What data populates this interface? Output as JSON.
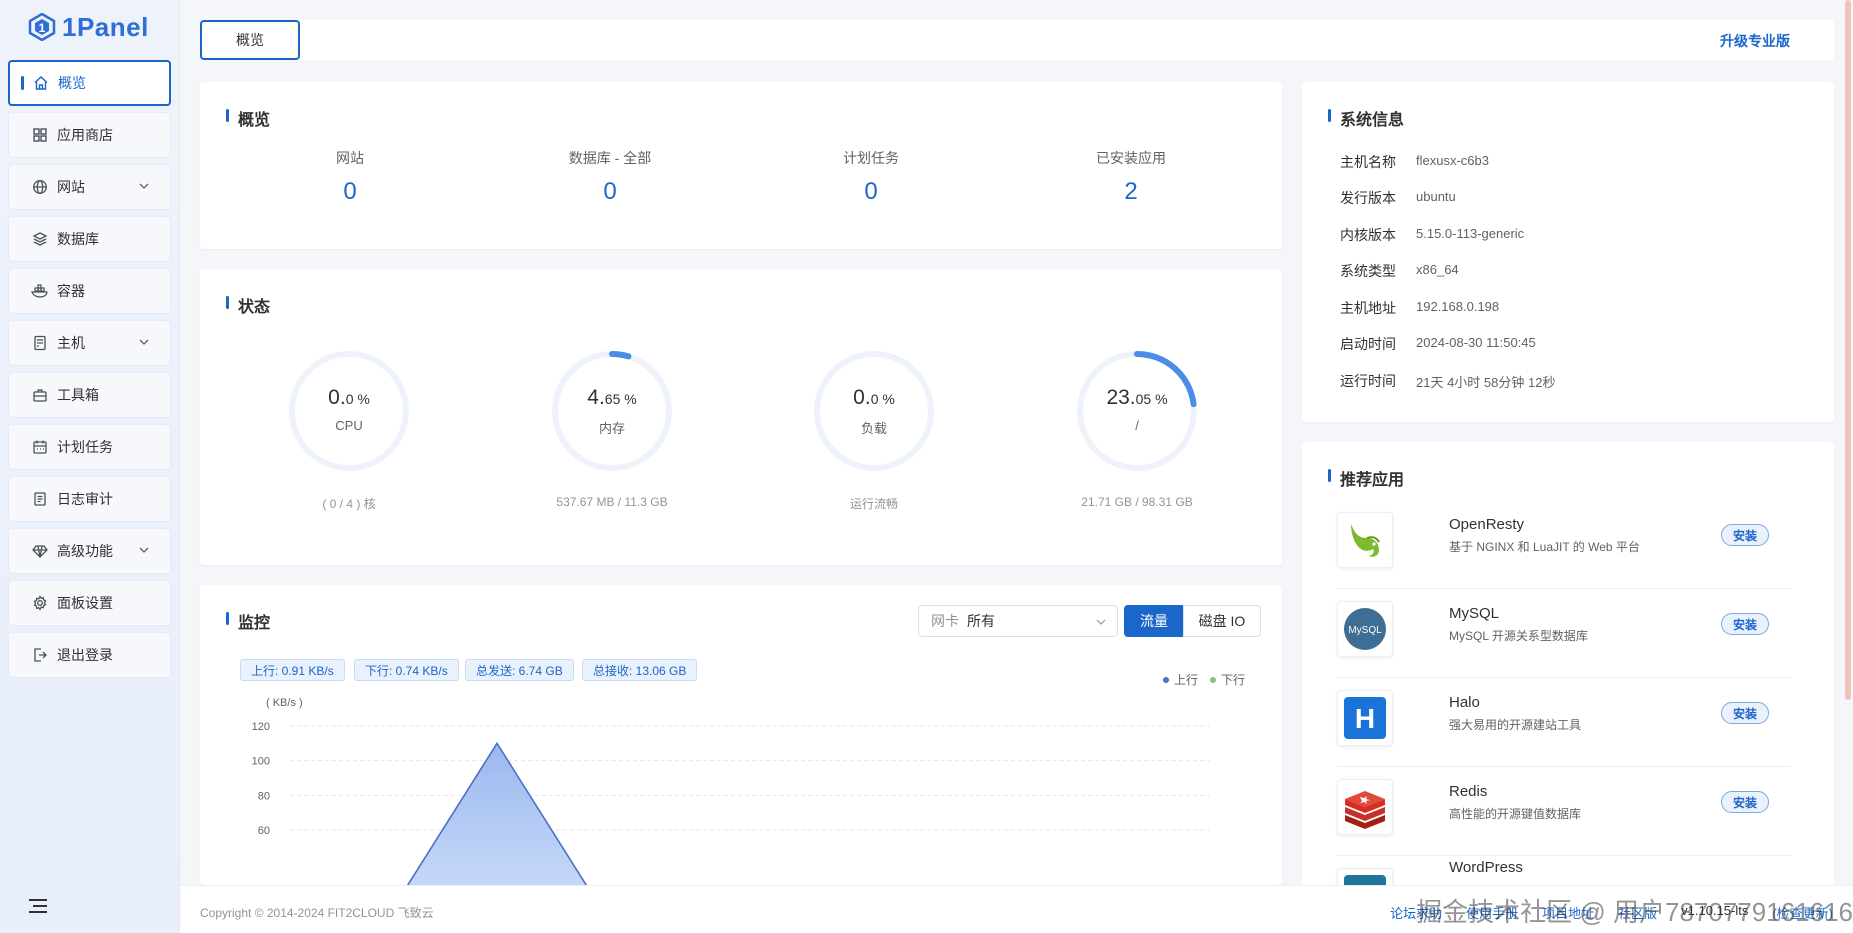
{
  "app": {
    "logo_text": "1Panel"
  },
  "sidebar": {
    "items": [
      {
        "label": "概览"
      },
      {
        "label": "应用商店"
      },
      {
        "label": "网站"
      },
      {
        "label": "数据库"
      },
      {
        "label": "容器"
      },
      {
        "label": "主机"
      },
      {
        "label": "工具箱"
      },
      {
        "label": "计划任务"
      },
      {
        "label": "日志审计"
      },
      {
        "label": "高级功能"
      },
      {
        "label": "面板设置"
      },
      {
        "label": "退出登录"
      }
    ]
  },
  "topbar": {
    "tab": "概览",
    "upgrade": "升级专业版"
  },
  "overview": {
    "title": "概览",
    "items": [
      {
        "label": "网站",
        "value": "0"
      },
      {
        "label": "数据库 - 全部",
        "value": "0"
      },
      {
        "label": "计划任务",
        "value": "0"
      },
      {
        "label": "已安装应用",
        "value": "2"
      }
    ]
  },
  "status": {
    "title": "状态",
    "gauges": [
      {
        "int": "0.",
        "dec": "0 %",
        "label": "CPU",
        "sub": "( 0 / 4 ) 核",
        "percent": 0.0
      },
      {
        "int": "4.",
        "dec": "65 %",
        "label": "内存",
        "sub": "537.67 MB / 11.3 GB",
        "percent": 4.65
      },
      {
        "int": "0.",
        "dec": "0 %",
        "label": "负载",
        "sub": "运行流畅",
        "percent": 0.0
      },
      {
        "int": "23.",
        "dec": "05 %",
        "label": "/",
        "sub": "21.71 GB / 98.31 GB",
        "percent": 23.05
      }
    ]
  },
  "monitor": {
    "title": "监控",
    "nic_label": "网卡",
    "nic_value": "所有",
    "seg_flow": "流量",
    "seg_disk": "磁盘 IO",
    "tags": [
      "上行: 0.91 KB/s",
      "下行: 0.74 KB/s",
      "总发送: 6.74 GB",
      "总接收: 13.06 GB"
    ],
    "legend_up": "上行",
    "legend_down": "下行",
    "color_up": "#4b6fc4",
    "color_down": "#84c77a"
  },
  "chart_data": {
    "type": "area",
    "ylabel": "( KB/s )",
    "y_ticks": [
      60,
      80,
      100,
      120
    ],
    "ylim": [
      0,
      120
    ],
    "series": [
      {
        "name": "上行",
        "x": [
          0,
          1,
          2,
          3,
          4,
          5,
          6
        ],
        "values": [
          0,
          0,
          110,
          0,
          0,
          0,
          0
        ]
      }
    ]
  },
  "system": {
    "title": "系统信息",
    "rows": [
      {
        "k": "主机名称",
        "v": "flexusx-c6b3"
      },
      {
        "k": "发行版本",
        "v": "ubuntu"
      },
      {
        "k": "内核版本",
        "v": "5.15.0-113-generic"
      },
      {
        "k": "系统类型",
        "v": "x86_64"
      },
      {
        "k": "主机地址",
        "v": "192.168.0.198"
      },
      {
        "k": "启动时间",
        "v": "2024-08-30 11:50:45"
      },
      {
        "k": "运行时间",
        "v": "21天 4小时 58分钟 12秒"
      }
    ]
  },
  "recommend": {
    "title": "推荐应用",
    "install": "安装",
    "apps": [
      {
        "name": "OpenResty",
        "desc": "基于 NGINX 和 LuaJIT 的 Web 平台",
        "icon": "openresty-logo"
      },
      {
        "name": "MySQL",
        "desc": "MySQL 开源关系型数据库",
        "icon": "mysql-logo",
        "logo_text": "MySQL"
      },
      {
        "name": "Halo",
        "desc": "强大易用的开源建站工具",
        "icon": "halo-logo",
        "logo_text": "H"
      },
      {
        "name": "Redis",
        "desc": "高性能的开源键值数据库",
        "icon": "redis-logo"
      },
      {
        "name": "WordPress",
        "desc": "",
        "icon": "wordpress-logo"
      }
    ]
  },
  "footer": {
    "copyright": "Copyright © 2014-2024 FIT2CLOUD 飞致云",
    "links": [
      "论坛求助",
      "使用手册",
      "项目地址",
      "社区版"
    ],
    "version": "v1.10.15-lts",
    "check": "(检查更新)",
    "watermark": "掘金技术社区 @ 用户7870779161616"
  }
}
